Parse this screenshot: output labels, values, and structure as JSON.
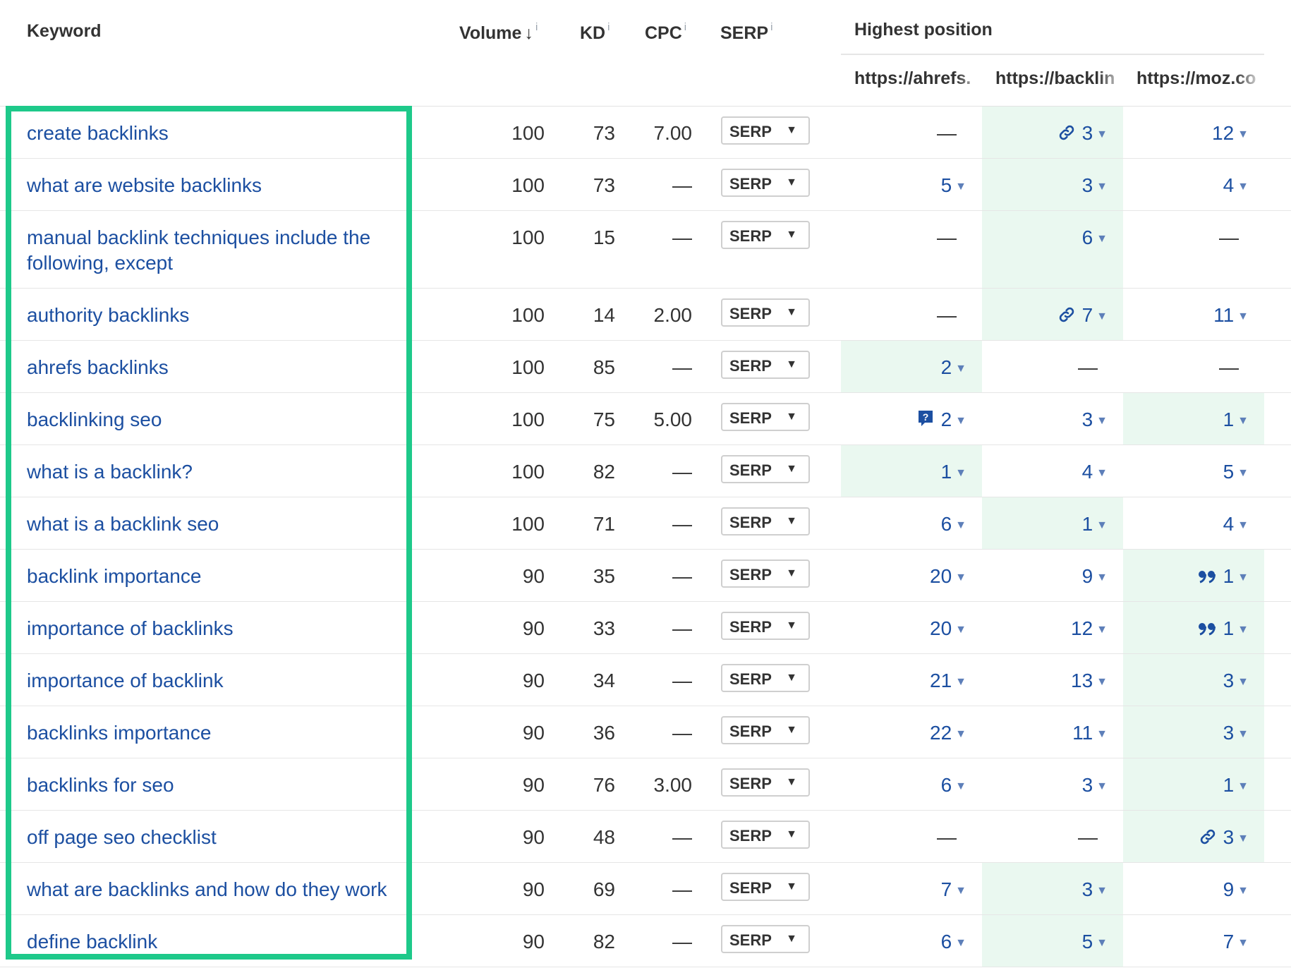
{
  "header": {
    "keyword": "Keyword",
    "volume": "Volume",
    "volume_sort_glyph": "↓",
    "kd": "KD",
    "cpc": "CPC",
    "serp": "SERP",
    "info_glyph": "i",
    "highest_position": "Highest position",
    "sites": [
      "https://ahrefs.",
      "https://backlin",
      "https://moz.co"
    ]
  },
  "serp_button_label": "SERP",
  "highlight_color": "#eaf8f0",
  "link_color": "#1c4fa1",
  "green_box_color": "#1ec98a",
  "rows": [
    {
      "keyword": "create backlinks",
      "volume": "100",
      "kd": "73",
      "cpc": "7.00",
      "positions": [
        {
          "value": "—",
          "dash": true
        },
        {
          "value": "3",
          "icon": "link-icon",
          "hl": true
        },
        {
          "value": "12"
        }
      ]
    },
    {
      "keyword": "what are website backlinks",
      "volume": "100",
      "kd": "73",
      "cpc": "—",
      "positions": [
        {
          "value": "5"
        },
        {
          "value": "3",
          "hl": true
        },
        {
          "value": "4"
        }
      ]
    },
    {
      "keyword": "manual backlink techniques include the following, except",
      "volume": "100",
      "kd": "15",
      "cpc": "—",
      "tall": true,
      "positions": [
        {
          "value": "—",
          "dash": true
        },
        {
          "value": "6",
          "hl": true
        },
        {
          "value": "—",
          "dash": true
        }
      ]
    },
    {
      "keyword": "authority backlinks",
      "volume": "100",
      "kd": "14",
      "cpc": "2.00",
      "positions": [
        {
          "value": "—",
          "dash": true
        },
        {
          "value": "7",
          "icon": "link-icon",
          "hl": true
        },
        {
          "value": "11"
        }
      ]
    },
    {
      "keyword": "ahrefs backlinks",
      "volume": "100",
      "kd": "85",
      "cpc": "—",
      "positions": [
        {
          "value": "2",
          "hl": true
        },
        {
          "value": "—",
          "dash": true
        },
        {
          "value": "—",
          "dash": true
        }
      ]
    },
    {
      "keyword": "backlinking seo",
      "volume": "100",
      "kd": "75",
      "cpc": "5.00",
      "positions": [
        {
          "value": "2",
          "icon": "question-bubble-icon"
        },
        {
          "value": "3"
        },
        {
          "value": "1",
          "hl": true
        }
      ]
    },
    {
      "keyword": "what is a backlink?",
      "volume": "100",
      "kd": "82",
      "cpc": "—",
      "positions": [
        {
          "value": "1",
          "hl": true
        },
        {
          "value": "4"
        },
        {
          "value": "5"
        }
      ]
    },
    {
      "keyword": "what is a backlink seo",
      "volume": "100",
      "kd": "71",
      "cpc": "—",
      "positions": [
        {
          "value": "6"
        },
        {
          "value": "1",
          "hl": true
        },
        {
          "value": "4"
        }
      ]
    },
    {
      "keyword": "backlink importance",
      "volume": "90",
      "kd": "35",
      "cpc": "—",
      "positions": [
        {
          "value": "20"
        },
        {
          "value": "9"
        },
        {
          "value": "1",
          "icon": "quote-icon",
          "hl": true
        }
      ]
    },
    {
      "keyword": "importance of backlinks",
      "volume": "90",
      "kd": "33",
      "cpc": "—",
      "positions": [
        {
          "value": "20"
        },
        {
          "value": "12"
        },
        {
          "value": "1",
          "icon": "quote-icon",
          "hl": true
        }
      ]
    },
    {
      "keyword": "importance of backlink",
      "volume": "90",
      "kd": "34",
      "cpc": "—",
      "positions": [
        {
          "value": "21"
        },
        {
          "value": "13"
        },
        {
          "value": "3",
          "hl": true
        }
      ]
    },
    {
      "keyword": "backlinks importance",
      "volume": "90",
      "kd": "36",
      "cpc": "—",
      "positions": [
        {
          "value": "22"
        },
        {
          "value": "11"
        },
        {
          "value": "3",
          "hl": true
        }
      ]
    },
    {
      "keyword": "backlinks for seo",
      "volume": "90",
      "kd": "76",
      "cpc": "3.00",
      "positions": [
        {
          "value": "6"
        },
        {
          "value": "3"
        },
        {
          "value": "1",
          "hl": true
        }
      ]
    },
    {
      "keyword": "off page seo checklist",
      "volume": "90",
      "kd": "48",
      "cpc": "—",
      "positions": [
        {
          "value": "—",
          "dash": true
        },
        {
          "value": "—",
          "dash": true
        },
        {
          "value": "3",
          "icon": "link-icon",
          "hl": true
        }
      ]
    },
    {
      "keyword": "what are backlinks and how do they work",
      "volume": "90",
      "kd": "69",
      "cpc": "—",
      "positions": [
        {
          "value": "7"
        },
        {
          "value": "3",
          "hl": true
        },
        {
          "value": "9"
        }
      ]
    },
    {
      "keyword": "define backlink",
      "volume": "90",
      "kd": "82",
      "cpc": "—",
      "positions": [
        {
          "value": "6"
        },
        {
          "value": "5",
          "hl": true
        },
        {
          "value": "7"
        }
      ]
    }
  ]
}
